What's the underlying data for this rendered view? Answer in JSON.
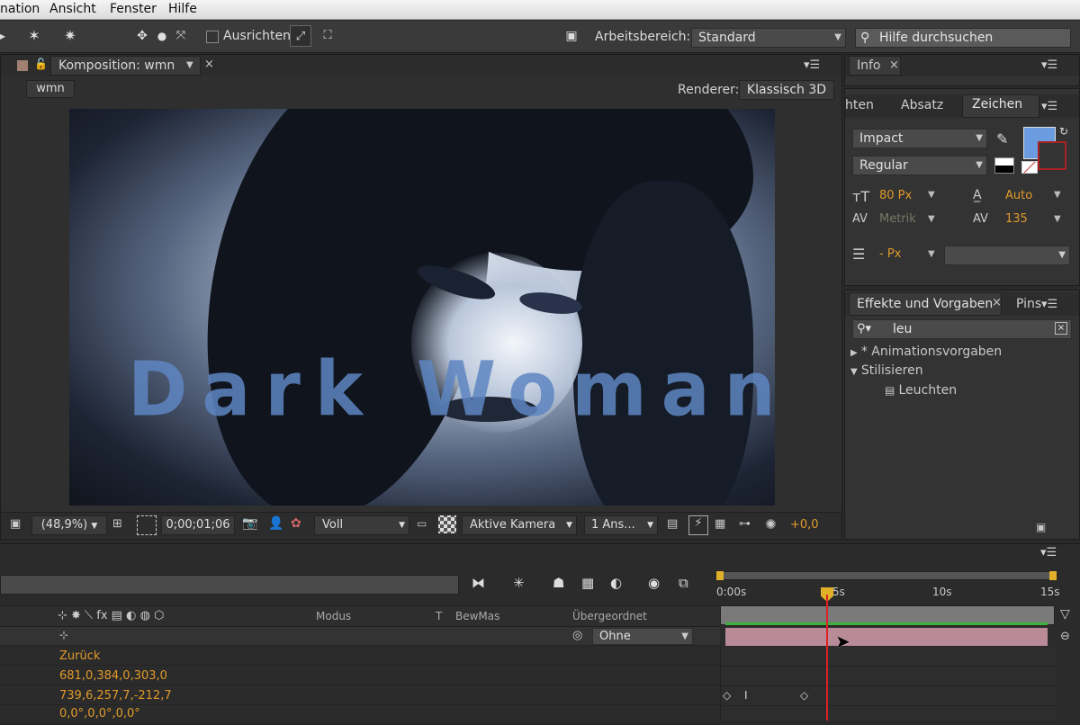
{
  "menu": {
    "items": [
      "nation",
      "Ansicht",
      "Fenster",
      "Hilfe"
    ]
  },
  "toolbar": {
    "align_label": "Ausrichten",
    "workspace_label": "Arbeitsbereich:",
    "workspace_value": "Standard",
    "help_search_placeholder": "Hilfe durchsuchen"
  },
  "composition": {
    "tab_label": "Komposition: wmn",
    "breadcrumb": "wmn",
    "renderer_label": "Renderer:",
    "renderer_value": "Klassisch 3D",
    "title_text": "Dark Woman",
    "zoom": "(48,9%)",
    "timecode": "0;00;01;06",
    "resolution": "Voll",
    "camera": "Aktive Kamera",
    "views": "1 Ans...",
    "exposure": "+0,0"
  },
  "info_panel": {
    "tab_label": "Info"
  },
  "character_panel": {
    "tabs": [
      "hten",
      "Absatz",
      "Zeichen"
    ],
    "font_family": "Impact",
    "font_style": "Regular",
    "font_size": "80 Px",
    "leading": "Auto",
    "kerning": "Metrik",
    "tracking": "135",
    "stroke_width": "- Px",
    "fill_color": "#6b9be0"
  },
  "effects_panel": {
    "tab_label": "Effekte und Vorgaben",
    "tab2_label": "Pins",
    "search_value": "leu",
    "tree": [
      {
        "label": "* Animationsvorgaben",
        "level": 0,
        "expanded": false
      },
      {
        "label": "Stilisieren",
        "level": 0,
        "expanded": true
      },
      {
        "label": "Leuchten",
        "level": 1,
        "expanded": false
      }
    ]
  },
  "timeline": {
    "columns": {
      "mode": "Modus",
      "t": "T",
      "trkmat": "BewMas",
      "parent": "Übergeordnet"
    },
    "parent_value": "Ohne",
    "ruler_labels": [
      "0:00s",
      "5s",
      "10s",
      "15s"
    ],
    "properties": [
      {
        "value": "Zurück"
      },
      {
        "value": "681,0,384,0,303,0"
      },
      {
        "value": "739,6,257,7,-212,7"
      },
      {
        "value": "0,0°,0,0°,0,0°"
      }
    ]
  }
}
